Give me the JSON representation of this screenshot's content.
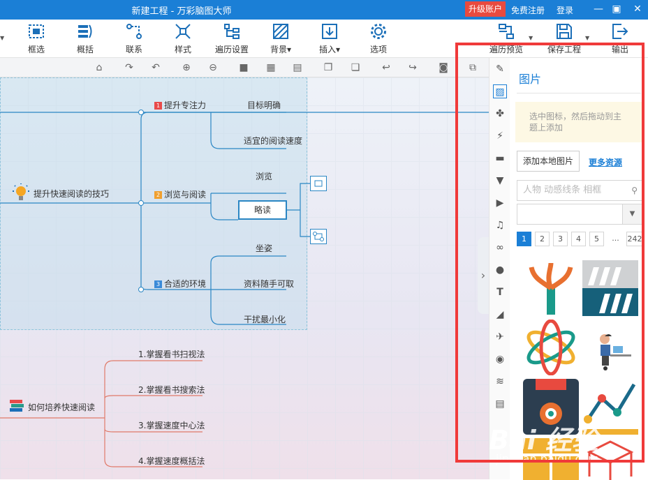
{
  "titlebar": {
    "title": "新建工程 - 万彩脑图大师",
    "upgrade": "升级账户",
    "register": "免费注册",
    "login": "登录"
  },
  "toolbar": {
    "items": [
      "框选",
      "概括",
      "联系",
      "样式",
      "遍历设置",
      "背景▾",
      "插入▾",
      "选项"
    ],
    "right_items": [
      "遍历预览",
      "保存工程",
      "输出"
    ]
  },
  "mindmap": {
    "root1": "提升快速阅读的技巧",
    "branches": [
      {
        "num": "1",
        "label": "提升专注力",
        "children": [
          "目标明确",
          "适宜的阅读速度"
        ]
      },
      {
        "num": "2",
        "label": "浏览与阅读",
        "children": [
          "浏览",
          "略读"
        ]
      },
      {
        "num": "3",
        "label": "合适的环境",
        "children": [
          "坐姿",
          "资料随手可取",
          "干扰最小化"
        ]
      }
    ],
    "root2": "如何培养快速阅读",
    "branches2": [
      "1.掌握看书扫视法",
      "2.掌握看书搜索法",
      "3.掌握速度中心法",
      "4.掌握速度概括法"
    ]
  },
  "panel": {
    "title": "图片",
    "hint": "选中图标，然后拖动到主题上添加",
    "add_button": "添加本地图片",
    "more_link": "更多资源",
    "search_placeholder": "人物 动感线条 相框",
    "pages": [
      "1",
      "2",
      "3",
      "4",
      "5",
      "...",
      "242"
    ]
  },
  "colors": {
    "accent": "#1b7fd6",
    "highlight": "#f03a3a",
    "branch_line": "#2a86c4",
    "branch2_line": "#e07a6a"
  },
  "watermark": {
    "text": "Bai 经验",
    "url": "jingyan.baidu.com"
  }
}
